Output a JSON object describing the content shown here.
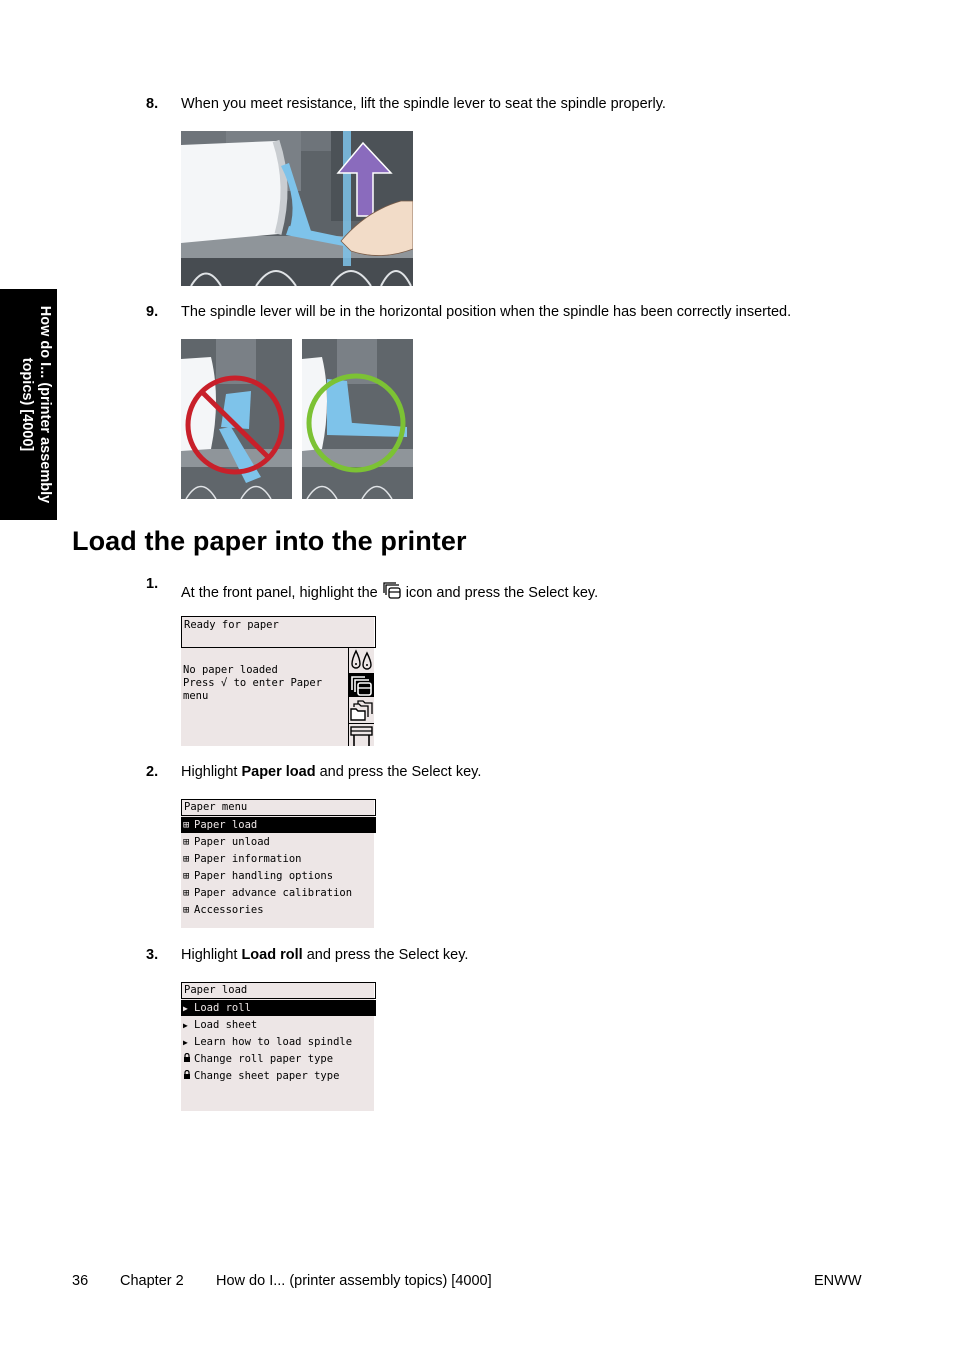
{
  "side_tab": {
    "label": "How do I... (printer assembly topics) [4000]"
  },
  "steps_top": [
    {
      "number": "8.",
      "text": "When you meet resistance, lift the spindle lever to seat the spindle properly.",
      "image_alt": "Hand lifting the blue spindle lever upward, purple arrow pointing up"
    },
    {
      "number": "9.",
      "text": "The spindle lever will be in the horizontal position when the spindle has been correctly inserted.",
      "images_alt": [
        "Incorrect: lever down, red prohibited sign",
        "Correct: lever horizontal, green circle"
      ]
    }
  ],
  "section": {
    "title": "Load the paper into the printer",
    "steps": [
      {
        "number": "1.",
        "text_before": "At the front panel, highlight the ",
        "icon": "paper-icon",
        "text_after": " icon and press the Select key."
      },
      {
        "number": "2.",
        "text_before": "Highlight ",
        "bold": "Paper load",
        "text_after": " and press the Select key."
      },
      {
        "number": "3.",
        "text_before": "Highlight ",
        "bold": "Load roll",
        "text_after": " and press the Select key."
      }
    ]
  },
  "panel1": {
    "title": "Ready for paper",
    "lines": [
      "No paper loaded",
      "Press √ to enter Paper",
      "menu"
    ],
    "side_icons": [
      "ink-drops-icon",
      "paper-icon",
      "folder-icon",
      "printer-icon"
    ],
    "selected_icon": "paper-icon"
  },
  "panel2": {
    "title": "Paper menu",
    "items": [
      {
        "glyph": "⊞",
        "label": "Paper load",
        "selected": true
      },
      {
        "glyph": "⊞",
        "label": "Paper unload",
        "selected": false
      },
      {
        "glyph": "⊞",
        "label": "Paper information",
        "selected": false
      },
      {
        "glyph": "⊞",
        "label": "Paper handling options",
        "selected": false
      },
      {
        "glyph": "⊞",
        "label": "Paper advance calibration",
        "selected": false
      },
      {
        "glyph": "⊞",
        "label": "Accessories",
        "selected": false
      }
    ]
  },
  "panel3": {
    "title": "Paper load",
    "items": [
      {
        "glyph": "▶",
        "label": "Load roll",
        "selected": true
      },
      {
        "glyph": "▶",
        "label": "Load sheet",
        "selected": false
      },
      {
        "glyph": "▶",
        "label": "Learn how to load spindle",
        "selected": false
      },
      {
        "glyph": "🔒",
        "label": "Change roll paper type",
        "selected": false
      },
      {
        "glyph": "🔒",
        "label": "Change sheet paper type",
        "selected": false
      }
    ]
  },
  "footer": {
    "page_number": "36",
    "chapter": "Chapter 2",
    "chapter_title": "How do I... (printer assembly topics) [4000]",
    "locale": "ENWW"
  },
  "colors": {
    "lcd_background": "#ede6e6",
    "lever_blue": "#7ec3ea",
    "arrow_purple": "#8a6bbd",
    "prohibit_red": "#c8202a",
    "ok_green": "#7cc234"
  }
}
